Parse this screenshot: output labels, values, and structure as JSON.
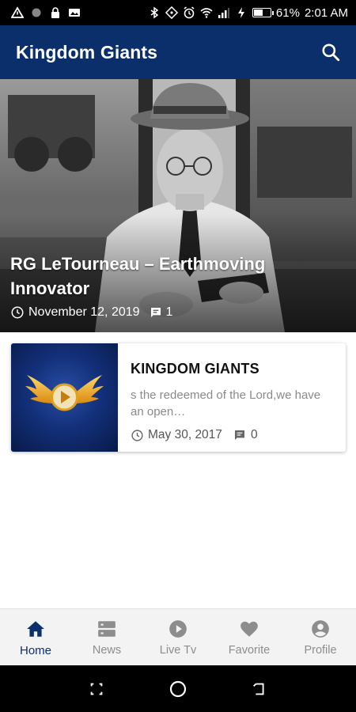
{
  "status_bar": {
    "battery_text": "61%",
    "battery_level": 0.61,
    "time": "2:01 AM",
    "icons": [
      "warning-icon",
      "dot-icon",
      "lock-icon",
      "image-icon",
      "bluetooth-icon",
      "rotate-icon",
      "alarm-icon",
      "wifi-icon",
      "signal-icon",
      "charging-icon",
      "battery-icon"
    ]
  },
  "app_bar": {
    "title": "Kingdom Giants",
    "search_icon": "search-icon"
  },
  "hero": {
    "title": "RG LeTourneau – Earthmoving Innovator",
    "date": "November 12, 2019",
    "comments": "1"
  },
  "posts": [
    {
      "title": "KINGDOM GIANTS",
      "excerpt": "s the redeemed of the Lord,we have an open…",
      "date": "May 30, 2017",
      "comments": "0"
    }
  ],
  "bottom_nav": {
    "items": [
      {
        "label": "Home",
        "icon": "home-icon",
        "active": true
      },
      {
        "label": "News",
        "icon": "news-icon",
        "active": false
      },
      {
        "label": "Live Tv",
        "icon": "play-circle-icon",
        "active": false
      },
      {
        "label": "Favorite",
        "icon": "heart-icon",
        "active": false
      },
      {
        "label": "Profile",
        "icon": "account-icon",
        "active": false
      }
    ]
  },
  "colors": {
    "primary": "#0b2f6b",
    "nav_inactive": "#8d8d8d",
    "excerpt": "#8a8a8a"
  }
}
